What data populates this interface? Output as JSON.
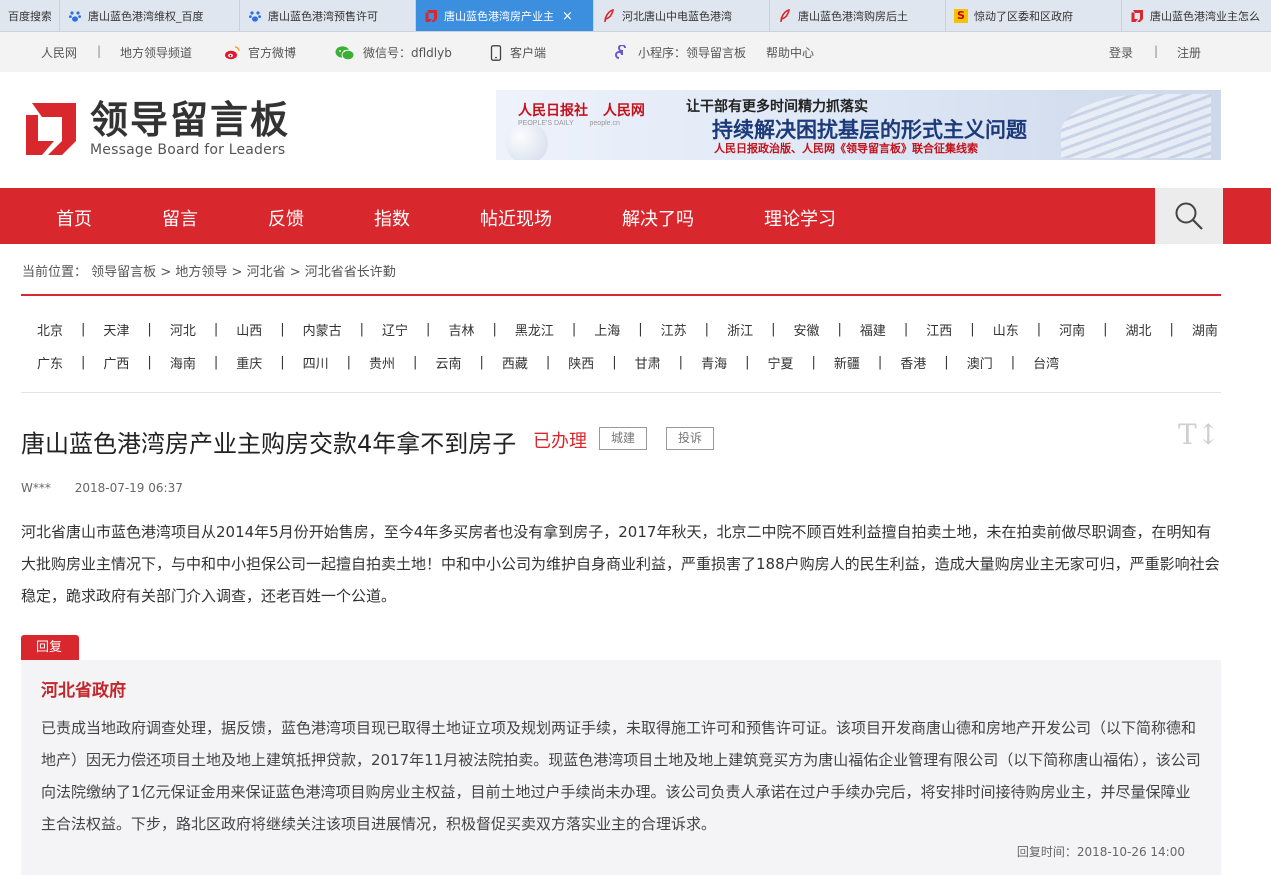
{
  "browser": {
    "tabs": [
      {
        "label": "百度搜索",
        "icon": "none",
        "active": false,
        "width": 60
      },
      {
        "label": "唐山蓝色港湾维权_百度",
        "icon": "paw",
        "active": false,
        "width": 180
      },
      {
        "label": "唐山蓝色港湾预售许可",
        "icon": "paw",
        "active": false,
        "width": 176
      },
      {
        "label": "唐山蓝色港湾房产业主",
        "icon": "logo",
        "active": true,
        "width": 178
      },
      {
        "label": "河北唐山中电蓝色港湾",
        "icon": "feather",
        "active": false,
        "width": 176
      },
      {
        "label": "唐山蓝色港湾购房后土",
        "icon": "feather",
        "active": false,
        "width": 176
      },
      {
        "label": "惊动了区委和区政府",
        "icon": "s",
        "active": false,
        "width": 176
      },
      {
        "label": "唐山蓝色港湾业主怎么",
        "icon": "logo",
        "active": false,
        "width": 150
      }
    ],
    "close_label": "×"
  },
  "topbar": {
    "people_net": "人民网",
    "sep": "|",
    "local_channel": "地方领导频道",
    "weibo": "官方微博",
    "wechat": "微信号：dfldlyb",
    "client": "客户端",
    "miniapp": "小程序：领导留言板",
    "help": "帮助中心",
    "login": "登录",
    "register": "注册"
  },
  "header": {
    "logo_cn": "领导留言板",
    "logo_en": "Message Board for Leaders",
    "banner": {
      "logo_rmrb": "人民日报社",
      "logo_rmrb_en": "PEOPLE'S DAILY",
      "logo_rmw": "人民网",
      "logo_rmw_en": "people.cn",
      "line1": "让干部有更多时间精力抓落实",
      "line2": "持续解决困扰基层的形式主义问题",
      "line3": "人民日报政治版、人民网《领导留言板》联合征集线索"
    }
  },
  "nav": {
    "items": [
      "首页",
      "留言",
      "反馈",
      "指数",
      "帖近现场",
      "解决了吗",
      "理论学习"
    ]
  },
  "breadcrumb": {
    "prefix": "当前位置：",
    "items": [
      "领导留言板",
      "地方领导",
      "河北省",
      "河北省省长许勤"
    ],
    "sep": ">"
  },
  "provinces": {
    "row1": [
      "北京",
      "天津",
      "河北",
      "山西",
      "内蒙古",
      "辽宁",
      "吉林",
      "黑龙江",
      "上海",
      "江苏",
      "浙江",
      "安徽",
      "福建",
      "江西",
      "山东",
      "河南",
      "湖北",
      "湖南"
    ],
    "row2": [
      "广东",
      "广西",
      "海南",
      "重庆",
      "四川",
      "贵州",
      "云南",
      "西藏",
      "陕西",
      "甘肃",
      "青海",
      "宁夏",
      "新疆",
      "香港",
      "澳门",
      "台湾"
    ]
  },
  "article": {
    "title": "唐山蓝色港湾房产业主购房交款4年拿不到房子",
    "status": "已办理",
    "tags": [
      "城建",
      "投诉"
    ],
    "font_toggle": "T↕",
    "author": "W***",
    "date": "2018-07-19 06:37",
    "body": "河北省唐山市蓝色港湾项目从2014年5月份开始售房，至今4年多买房者也没有拿到房子，2017年秋天，北京二中院不顾百姓利益擅自拍卖土地，未在拍卖前做尽职调查，在明知有大批购房业主情况下，与中和中小担保公司一起擅自拍卖土地！中和中小公司为维护自身商业利益，严重损害了188户购房人的民生利益，造成大量购房业主无家可归，严重影响社会稳定，跪求政府有关部门介入调查，还老百姓一个公道。"
  },
  "reply": {
    "tag": "回复",
    "org": "河北省政府",
    "body": "已责成当地政府调查处理，据反馈，蓝色港湾项目现已取得土地证立项及规划两证手续，未取得施工许可和预售许可证。该项目开发商唐山德和房地产开发公司（以下简称德和地产）因无力偿还项目土地及地上建筑抵押贷款，2017年11月被法院拍卖。现蓝色港湾项目土地及地上建筑竞买方为唐山福佑企业管理有限公司（以下简称唐山福佑），该公司向法院缴纳了1亿元保证金用来保证蓝色港湾项目购房业主权益，目前土地过户手续尚未办理。该公司负责人承诺在过户手续办完后，将安排时间接待购房业主，并尽量保障业主合法权益。下步，路北区政府将继续关注该项目进展情况，积极督促买卖双方落实业主的合理诉求。",
    "time_label": "回复时间：",
    "time": "2018-10-26 14:00"
  },
  "colors": {
    "brand_red": "#d8272d",
    "tab_active": "#3c8fdf"
  }
}
